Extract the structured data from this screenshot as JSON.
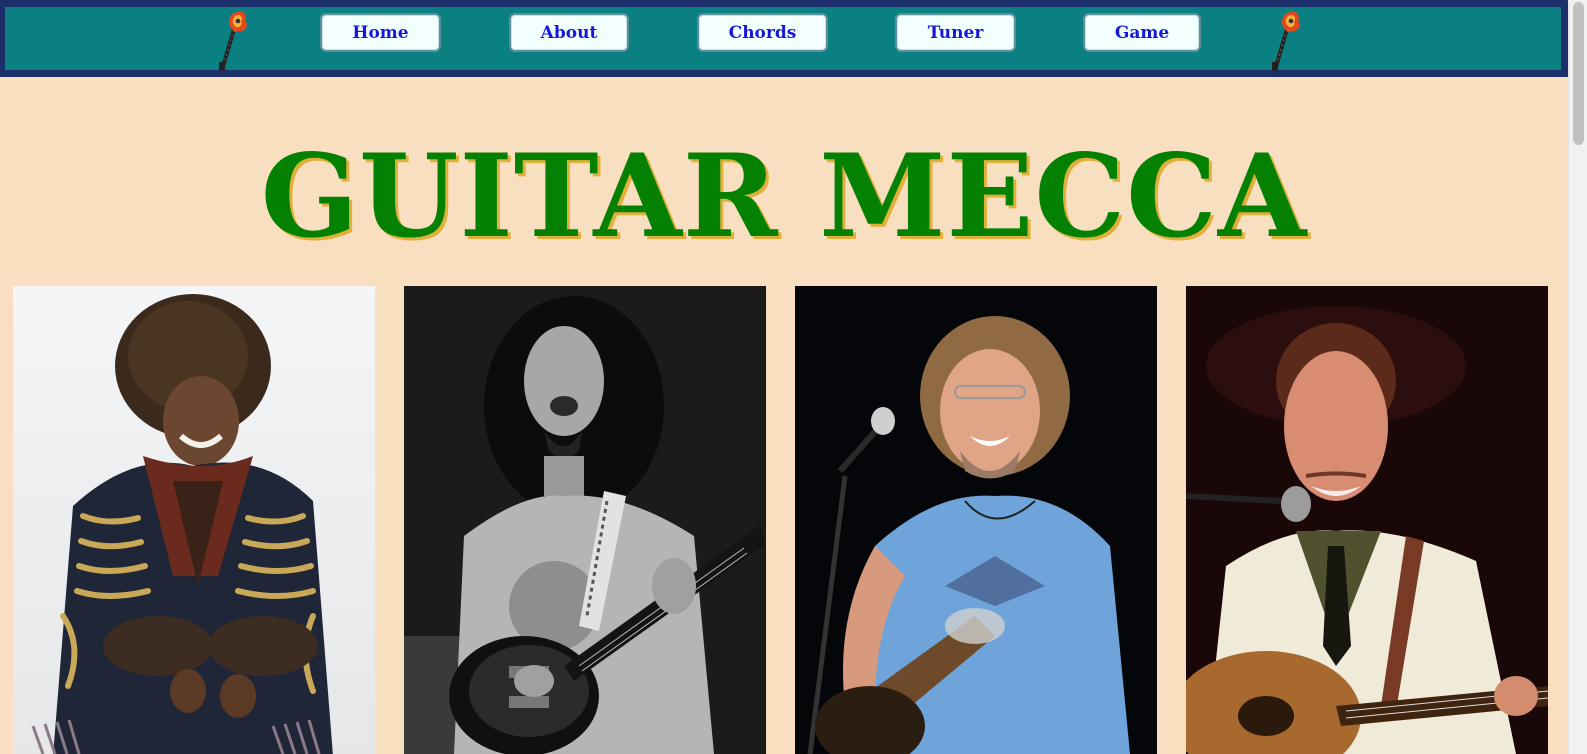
{
  "nav": {
    "items": [
      {
        "label": "Home"
      },
      {
        "label": "About"
      },
      {
        "label": "Chords"
      },
      {
        "label": "Tuner"
      },
      {
        "label": "Game"
      }
    ],
    "colors": {
      "bar": "#0b8082",
      "border": "#1d2f6b",
      "button_text": "#1717d9",
      "button_bg": "#f3fffe"
    },
    "decoration_icons": [
      "guitar-icon",
      "guitar-icon"
    ]
  },
  "page": {
    "title": "GUITAR MECCA",
    "title_color": "#048102",
    "title_shadow_color": "#e0b03a",
    "background": "#f7dfbf"
  },
  "gallery": {
    "photos": [
      {
        "subject": "guitarist-photo-1",
        "style": "color, light background"
      },
      {
        "subject": "guitarist-photo-2",
        "style": "black and white"
      },
      {
        "subject": "guitarist-photo-3",
        "style": "color, dark stage background"
      },
      {
        "subject": "guitarist-photo-4",
        "style": "color, dark stage background"
      }
    ]
  }
}
